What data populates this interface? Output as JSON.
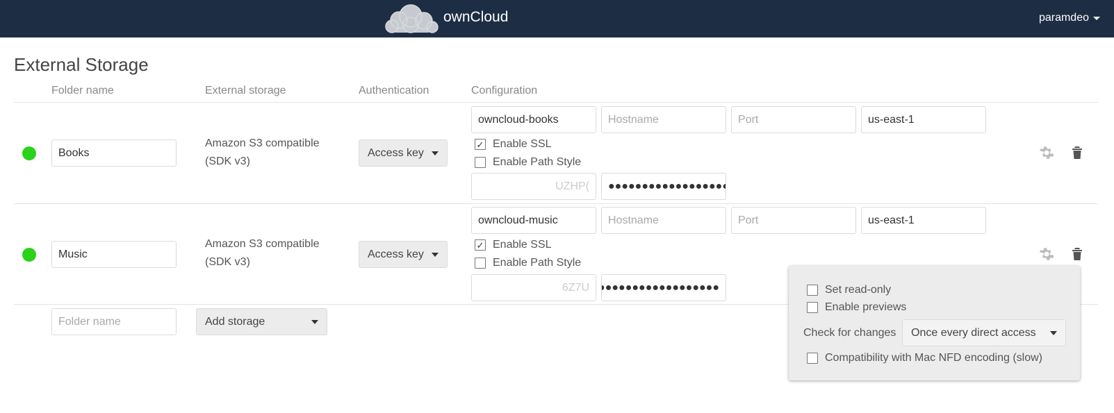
{
  "header": {
    "app_name": "ownCloud",
    "user": "paramdeo"
  },
  "page": {
    "title": "External Storage",
    "columns": {
      "folder_name": "Folder name",
      "external_storage": "External storage",
      "authentication": "Authentication",
      "configuration": "Configuration"
    }
  },
  "mounts": [
    {
      "status": "ok",
      "folder": "Books",
      "storage_line1": "Amazon S3 compatible",
      "storage_line2": "(SDK v3)",
      "auth": "Access key",
      "bucket": "owncloud-books",
      "hostname_placeholder": "Hostname",
      "port_placeholder": "Port",
      "region": "us-east-1",
      "enable_ssl": "Enable SSL",
      "enable_ssl_checked": true,
      "path_style": "Enable Path Style",
      "path_style_checked": false,
      "key_visible": "UZHP(",
      "secret_masked": "●●●●●●●●●●●●●●●●●●"
    },
    {
      "status": "ok",
      "folder": "Music",
      "storage_line1": "Amazon S3 compatible",
      "storage_line2": "(SDK v3)",
      "auth": "Access key",
      "bucket": "owncloud-music",
      "hostname_placeholder": "Hostname",
      "port_placeholder": "Port",
      "region": "us-east-1",
      "enable_ssl": "Enable SSL",
      "enable_ssl_checked": true,
      "path_style": "Enable Path Style",
      "path_style_checked": false,
      "key_visible": "6Z7U",
      "secret_masked": "●●●●●●●●●●●●●●●●●●"
    }
  ],
  "new_mount": {
    "folder_placeholder": "Folder name",
    "add_storage": "Add storage"
  },
  "options_popover": {
    "read_only": "Set read-only",
    "previews": "Enable previews",
    "check_changes_label": "Check for changes",
    "check_changes_value": "Once every direct access",
    "nfd": "Compatibility with Mac NFD encoding (slow)"
  },
  "colors": {
    "header_bg": "#1d2d44",
    "status_ok": "#2ad21a",
    "popover_bg": "#ececec"
  },
  "icons": [
    "owncloud-logo",
    "caret-down-icon",
    "gear-icon",
    "trash-icon",
    "checkbox-icon"
  ]
}
